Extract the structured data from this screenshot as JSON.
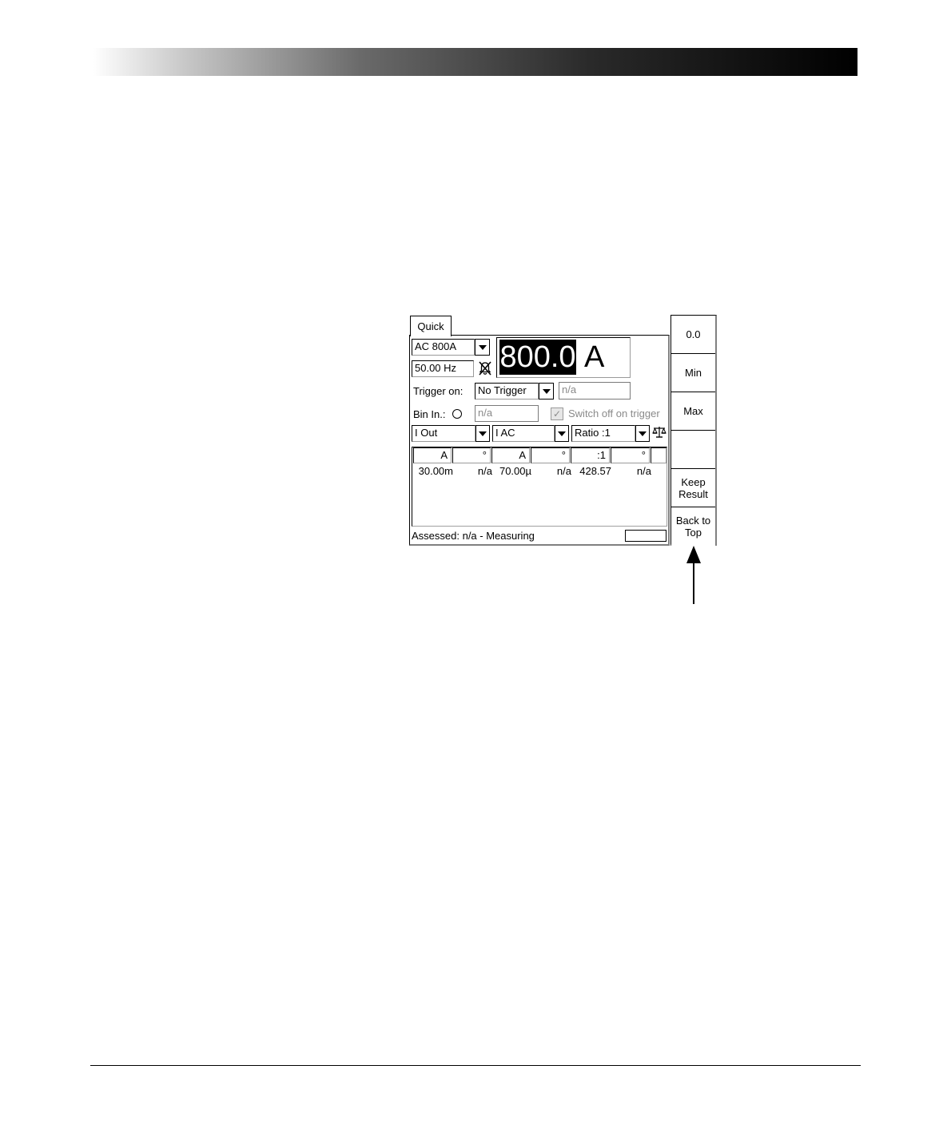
{
  "tab": {
    "label": "Quick"
  },
  "range": {
    "value": "AC 800A"
  },
  "frequency": {
    "value": "50.00 Hz"
  },
  "output": {
    "value": "800.0",
    "unit": "A"
  },
  "trigger": {
    "label": "Trigger on:",
    "value": "No Trigger",
    "extra": "n/a"
  },
  "binary_input": {
    "label": "Bin In.:",
    "value": "n/a"
  },
  "switch_off": {
    "label": "Switch off on trigger",
    "checked": true
  },
  "measure_selectors": [
    "I Out",
    "I AC",
    "Ratio :1"
  ],
  "table": {
    "headers": [
      "A",
      "°",
      "A",
      "°",
      ":1",
      "°"
    ],
    "row": [
      "30.00m",
      "n/a",
      "70.00µ",
      "n/a",
      "428.57",
      "n/a"
    ]
  },
  "status": {
    "text": "Assessed: n/a - Measuring"
  },
  "sidebar": {
    "buttons": [
      {
        "label": "0.0"
      },
      {
        "label": "Min"
      },
      {
        "label": "Max"
      },
      {
        "label": ""
      },
      {
        "label": "Keep Result"
      },
      {
        "label": "Back to Top"
      }
    ]
  },
  "icons": {
    "mute": "mute-bell-icon",
    "balance": "balance-scale-icon",
    "arrow": "up-arrow-icon"
  }
}
